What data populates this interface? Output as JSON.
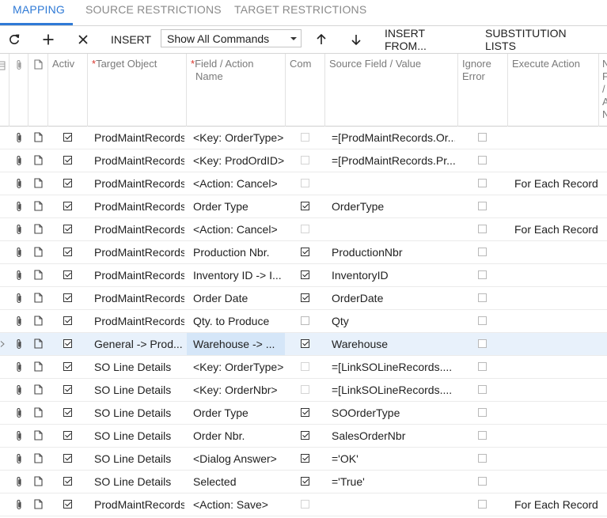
{
  "tabs": [
    {
      "label": "MAPPING",
      "active": true
    },
    {
      "label": "SOURCE RESTRICTIONS",
      "active": false
    },
    {
      "label": "TARGET RESTRICTIONS",
      "active": false
    }
  ],
  "toolbar": {
    "refresh_icon": "refresh-icon",
    "add_icon": "plus-icon",
    "delete_icon": "close-icon",
    "insert_label": "INSERT",
    "commands_filter": "Show All Commands",
    "move_up_icon": "arrow-up-icon",
    "move_down_icon": "arrow-down-icon",
    "insert_from_label": "INSERT FROM...",
    "substitution_lists_label": "SUBSTITUTION LISTS"
  },
  "columns": {
    "active": "Activ",
    "target_object": "Target Object",
    "field_action_line1": "Field / Action",
    "field_action_line2": "Name",
    "commit": "Com",
    "source_field": "Source Field / Value",
    "ignore_error_line1": "Ignore",
    "ignore_error_line2": "Error",
    "execute_action": "Execute Action",
    "last_col_fragments": [
      "N",
      "F",
      "/",
      "A",
      "N"
    ]
  },
  "colors": {
    "accent": "#2f7ad6",
    "required": "#d9342b",
    "selected_row": "#e8f1fb"
  },
  "rows": [
    {
      "active": true,
      "target": "ProdMaintRecords",
      "field": "<Key: OrderType>",
      "commit": false,
      "commit_dim": true,
      "source": "=[ProdMaintRecords.Or...",
      "ignore": false,
      "execute": ""
    },
    {
      "active": true,
      "target": "ProdMaintRecords",
      "field": "<Key: ProdOrdID>",
      "commit": false,
      "commit_dim": true,
      "source": "=[ProdMaintRecords.Pr...",
      "ignore": false,
      "execute": ""
    },
    {
      "active": true,
      "target": "ProdMaintRecords",
      "field": "<Action: Cancel>",
      "commit": false,
      "commit_dim": true,
      "source": "",
      "ignore": false,
      "execute": "For Each Record"
    },
    {
      "active": true,
      "target": "ProdMaintRecords",
      "field": "Order Type",
      "commit": true,
      "commit_dim": false,
      "source": "OrderType",
      "ignore": false,
      "execute": ""
    },
    {
      "active": true,
      "target": "ProdMaintRecords",
      "field": "<Action: Cancel>",
      "commit": false,
      "commit_dim": true,
      "source": "",
      "ignore": false,
      "execute": "For Each Record"
    },
    {
      "active": true,
      "target": "ProdMaintRecords",
      "field": "Production Nbr.",
      "commit": true,
      "commit_dim": false,
      "source": "ProductionNbr",
      "ignore": false,
      "execute": ""
    },
    {
      "active": true,
      "target": "ProdMaintRecords",
      "field": "Inventory ID -> I...",
      "commit": true,
      "commit_dim": false,
      "source": "InventoryID",
      "ignore": false,
      "execute": ""
    },
    {
      "active": true,
      "target": "ProdMaintRecords",
      "field": "Order Date",
      "commit": true,
      "commit_dim": false,
      "source": "OrderDate",
      "ignore": false,
      "execute": ""
    },
    {
      "active": true,
      "target": "ProdMaintRecords",
      "field": "Qty. to Produce",
      "commit": false,
      "commit_dim": false,
      "source": "Qty",
      "ignore": false,
      "execute": ""
    },
    {
      "active": true,
      "target": "General -> Prod...",
      "field": "Warehouse -> ...",
      "commit": true,
      "commit_dim": false,
      "source": "Warehouse",
      "ignore": false,
      "execute": "",
      "selected": true
    },
    {
      "active": true,
      "target": "SO Line Details",
      "field": "<Key: OrderType>",
      "commit": false,
      "commit_dim": true,
      "source": "=[LinkSOLineRecords....",
      "ignore": false,
      "execute": ""
    },
    {
      "active": true,
      "target": "SO Line Details",
      "field": "<Key: OrderNbr>",
      "commit": false,
      "commit_dim": true,
      "source": "=[LinkSOLineRecords....",
      "ignore": false,
      "execute": ""
    },
    {
      "active": true,
      "target": "SO Line Details",
      "field": "Order Type",
      "commit": true,
      "commit_dim": false,
      "source": "SOOrderType",
      "ignore": false,
      "execute": ""
    },
    {
      "active": true,
      "target": "SO Line Details",
      "field": "Order Nbr.",
      "commit": true,
      "commit_dim": false,
      "source": "SalesOrderNbr",
      "ignore": false,
      "execute": ""
    },
    {
      "active": true,
      "target": "SO Line Details",
      "field": "<Dialog Answer>",
      "commit": true,
      "commit_dim": false,
      "source": "='OK'",
      "ignore": false,
      "execute": ""
    },
    {
      "active": true,
      "target": "SO Line Details",
      "field": "Selected",
      "commit": true,
      "commit_dim": false,
      "source": "='True'",
      "ignore": false,
      "execute": ""
    },
    {
      "active": true,
      "target": "ProdMaintRecords",
      "field": "<Action: Save>",
      "commit": false,
      "commit_dim": true,
      "source": "",
      "ignore": false,
      "execute": "For Each Record"
    }
  ]
}
